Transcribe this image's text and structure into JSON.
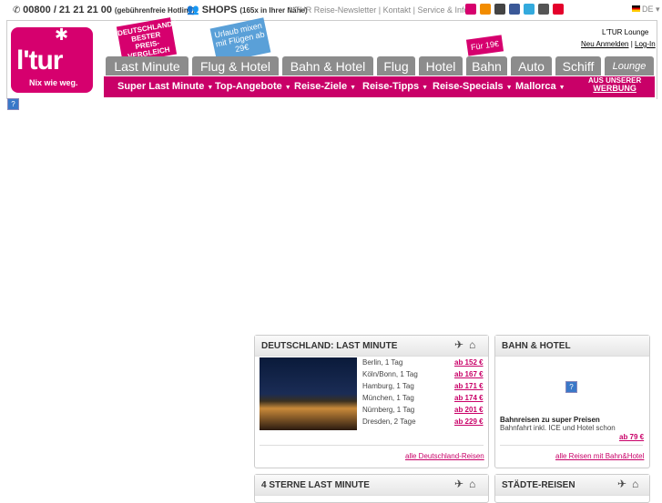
{
  "topbar": {
    "phone": "00800 / 21 21 21 00",
    "phone_note": "(gebührenfreie Hotline)",
    "shops": "SHOPS",
    "shops_note": "(165x in Ihrer Nähe)",
    "links": "L'TUR Reise-Newsletter | Kontakt | Service & Info",
    "lang": "DE"
  },
  "header": {
    "logo_word": "l'tur",
    "slogan": "Nix wie weg.",
    "badge_price": "DEUTSCHLANDS BESTER PREIS-VERGLEICH",
    "badge_urlaub": "Urlaub mixen mit Flügen ab 29€",
    "badge_19": "Für 19€",
    "lounge_title": "L'TUR Lounge",
    "register": "Neu Anmelden",
    "login": "Log-In"
  },
  "tabs": [
    "Last Minute",
    "Flug & Hotel",
    "Bahn & Hotel",
    "Flug",
    "Hotel",
    "Bahn",
    "Auto",
    "Schiff",
    "Lounge"
  ],
  "menu": [
    "Super Last Minute",
    "Top-Angebote",
    "Reise-Ziele",
    "Reise-Tipps",
    "Reise-Specials",
    "Mallorca"
  ],
  "ad_label": {
    "line1": "AUS UNSERER",
    "line2": "WERBUNG"
  },
  "help": "?",
  "de_box": {
    "title": "DEUTSCHLAND: LAST MINUTE",
    "deals": [
      {
        "label": "Berlin, 1 Tag",
        "price": "ab 152 €"
      },
      {
        "label": "Köln/Bonn, 1 Tag",
        "price": "ab 167 €"
      },
      {
        "label": "Hamburg, 1 Tag",
        "price": "ab 171 €"
      },
      {
        "label": "München, 1 Tag",
        "price": "ab 174 €"
      },
      {
        "label": "Nürnberg, 1 Tag",
        "price": "ab 201 €"
      },
      {
        "label": "Dresden, 2 Tage",
        "price": "ab 229 €"
      }
    ],
    "link": "alle Deutschland-Reisen"
  },
  "bahn_box": {
    "title": "BAHN & HOTEL",
    "headline": "Bahnreisen zu super Preisen",
    "text": "Bahnfahrt inkl. ICE und Hotel schon",
    "price": "ab 79 €",
    "link": "alle Reisen mit Bahn&Hotel"
  },
  "box3": {
    "title": "4 STERNE LAST MINUTE"
  },
  "box4": {
    "title": "STÄDTE-REISEN"
  },
  "colors": {
    "brand": "#c90068",
    "tab_grey": "#8c8c8c"
  },
  "icons": [
    "plane-icon",
    "house-icon",
    "mail-icon",
    "rss-icon",
    "mobile-icon",
    "facebook-icon",
    "twitter-icon",
    "youtube-icon",
    "star-icon"
  ]
}
